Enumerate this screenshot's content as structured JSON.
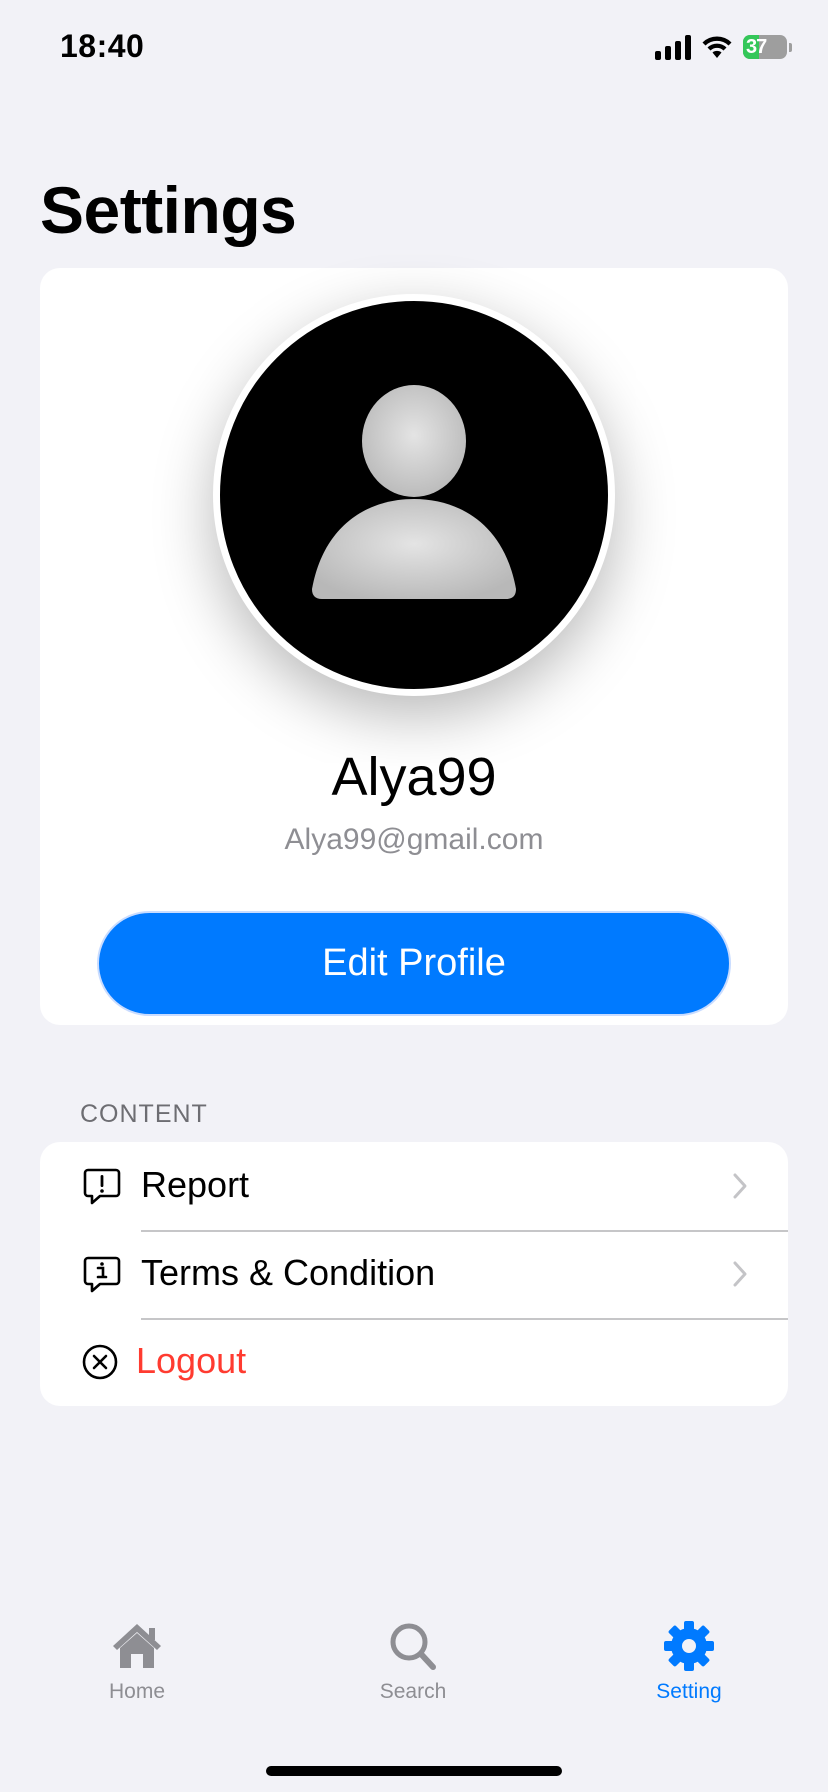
{
  "status_bar": {
    "time": "18:40",
    "battery_level": "37"
  },
  "page": {
    "title": "Settings"
  },
  "profile": {
    "username": "Alya99",
    "email": "Alya99@gmail.com",
    "edit_button_label": "Edit Profile"
  },
  "content_section": {
    "header": "CONTENT",
    "items": [
      {
        "label": "Report",
        "icon": "report-bubble-icon"
      },
      {
        "label": "Terms & Condition",
        "icon": "info-bubble-icon"
      },
      {
        "label": "Logout",
        "icon": "close-circle-icon"
      }
    ]
  },
  "tab_bar": {
    "tabs": [
      {
        "label": "Home",
        "icon": "house-icon",
        "active": false
      },
      {
        "label": "Search",
        "icon": "search-icon",
        "active": false
      },
      {
        "label": "Setting",
        "icon": "gear-icon",
        "active": true
      }
    ]
  },
  "colors": {
    "accent": "#007aff",
    "destructive": "#ff3b30",
    "background": "#f2f2f7",
    "battery": "#34c759"
  }
}
